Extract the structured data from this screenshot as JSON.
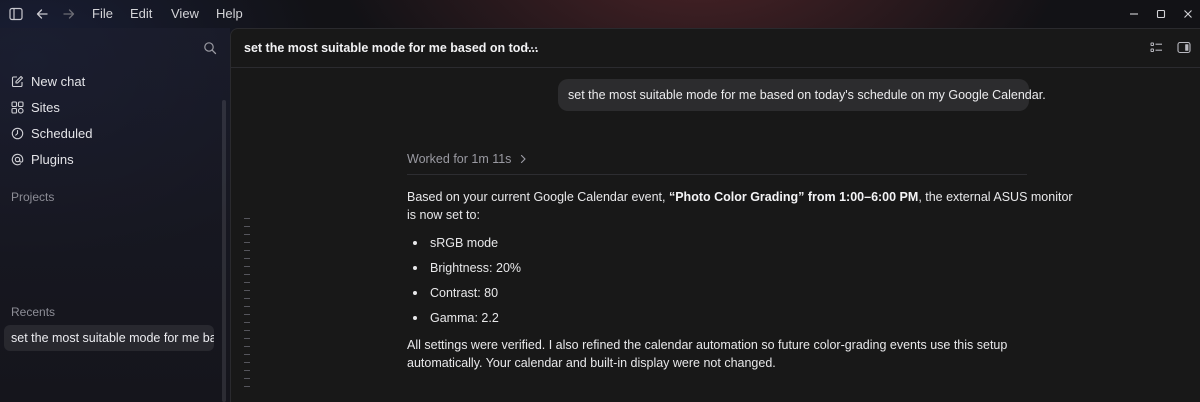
{
  "titlebar": {
    "menu": [
      "File",
      "Edit",
      "View",
      "Help"
    ]
  },
  "icons": {
    "sidebar_toggle": "sidebar-toggle-icon",
    "back": "arrow-left-icon",
    "forward": "arrow-right-icon",
    "minimize": "minimize-icon",
    "maximize": "maximize-icon",
    "close": "close-icon",
    "search": "search-icon",
    "more": "more-icon",
    "list": "list-icon",
    "panel": "panel-icon"
  },
  "sidebar": {
    "items": [
      {
        "label": "New chat",
        "icon": "edit-icon"
      },
      {
        "label": "Sites",
        "icon": "grid-icon"
      },
      {
        "label": "Scheduled",
        "icon": "clock-icon"
      },
      {
        "label": "Plugins",
        "icon": "at-icon"
      }
    ],
    "projects_label": "Projects",
    "recents_label": "Recents",
    "recent_item": "set the most suitable mode for me based on today's schedule on my Google Calendar."
  },
  "main": {
    "chat_title": "set the most suitable mode for me based on tod...",
    "user_message": "set the most suitable mode for me based on today's schedule on my Google Calendar.",
    "worked_label": "Worked for 1m 11s",
    "answer_intro_prefix": "Based on your current Google Calendar event, ",
    "answer_intro_bold": "“Photo Color Grading” from 1:00–6:00 PM",
    "answer_intro_suffix": ", the external ASUS monitor",
    "answer_intro_line2": "is now set to:",
    "bullets": [
      "sRGB mode",
      "Brightness: 20%",
      "Contrast: 80",
      "Gamma: 2.2"
    ],
    "answer_outro_line1": "All settings were verified. I also refined the calendar automation so future color-grading events use this setup",
    "answer_outro_line2": "automatically. Your calendar and built-in display were not changed."
  },
  "colors": {
    "background": "#121216",
    "main_panel": "#181818",
    "user_bubble": "#2c2c2e",
    "muted_text": "#9a9aa2"
  }
}
